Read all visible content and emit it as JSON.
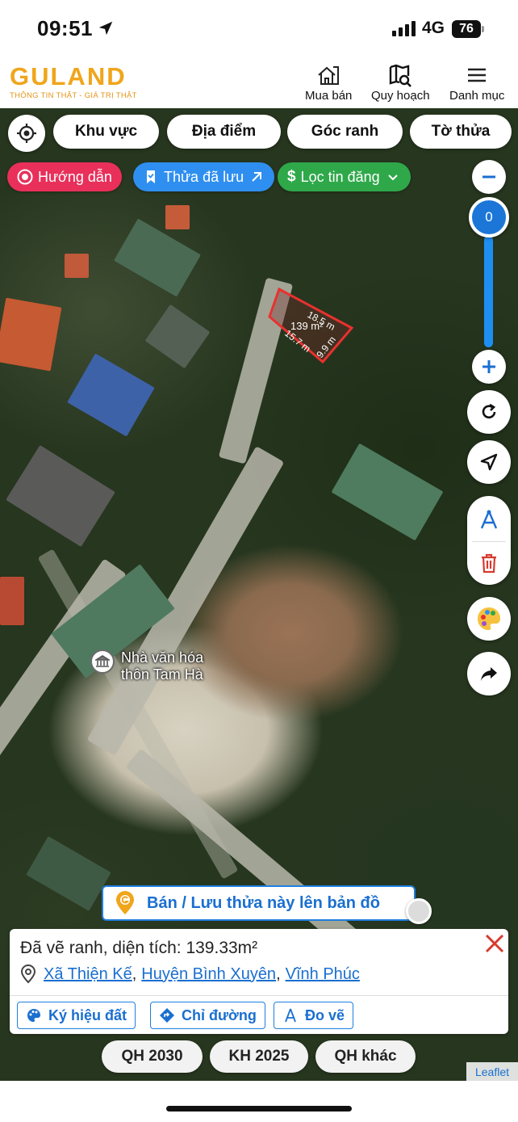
{
  "status": {
    "time": "09:51",
    "network": "4G",
    "battery": "76"
  },
  "header": {
    "brand": "GULAND",
    "slogan": "THÔNG TIN THẬT - GIÁ TRỊ THẬT",
    "nav": [
      {
        "label": "Mua bán",
        "icon": "house-icon"
      },
      {
        "label": "Quy hoạch",
        "icon": "map-search-icon"
      },
      {
        "label": "Danh mục",
        "icon": "hamburger-icon"
      }
    ]
  },
  "filters": [
    "Khu vực",
    "Địa điểm",
    "Góc ranh",
    "Tờ thửa"
  ],
  "pills": {
    "guide": "Hướng dẫn",
    "saved": "Thửa đã lưu",
    "listing": "Lọc tin đăng"
  },
  "zoom": {
    "level": "0"
  },
  "plot": {
    "area_label": "139 m²",
    "edges": [
      "18.5 m",
      "15.7 m",
      "9.9 m"
    ]
  },
  "poi": {
    "line1": "Nhà văn hóa",
    "line2": "thôn Tam Hà"
  },
  "sell_button": "Bán / Lưu thửa này lên bản đồ",
  "info": {
    "title": "Đã vẽ ranh, diện tích: 139.33m²",
    "address": [
      "Xã Thiện Kế",
      "Huyện Bình Xuyên",
      "Vĩnh Phúc"
    ],
    "actions": [
      "Ký hiệu đất",
      "Chỉ đường",
      "Đo vẽ"
    ]
  },
  "plans": [
    "QH 2030",
    "KH 2025",
    "QH khác"
  ],
  "attribution": "Leaflet",
  "colors": {
    "brand": "#f0a51b",
    "accent_blue": "#1e7fe0",
    "pill_red": "#e8305a",
    "pill_blue": "#2f8ff0",
    "pill_green": "#2fa84a",
    "plot_stroke": "#e8312f"
  }
}
